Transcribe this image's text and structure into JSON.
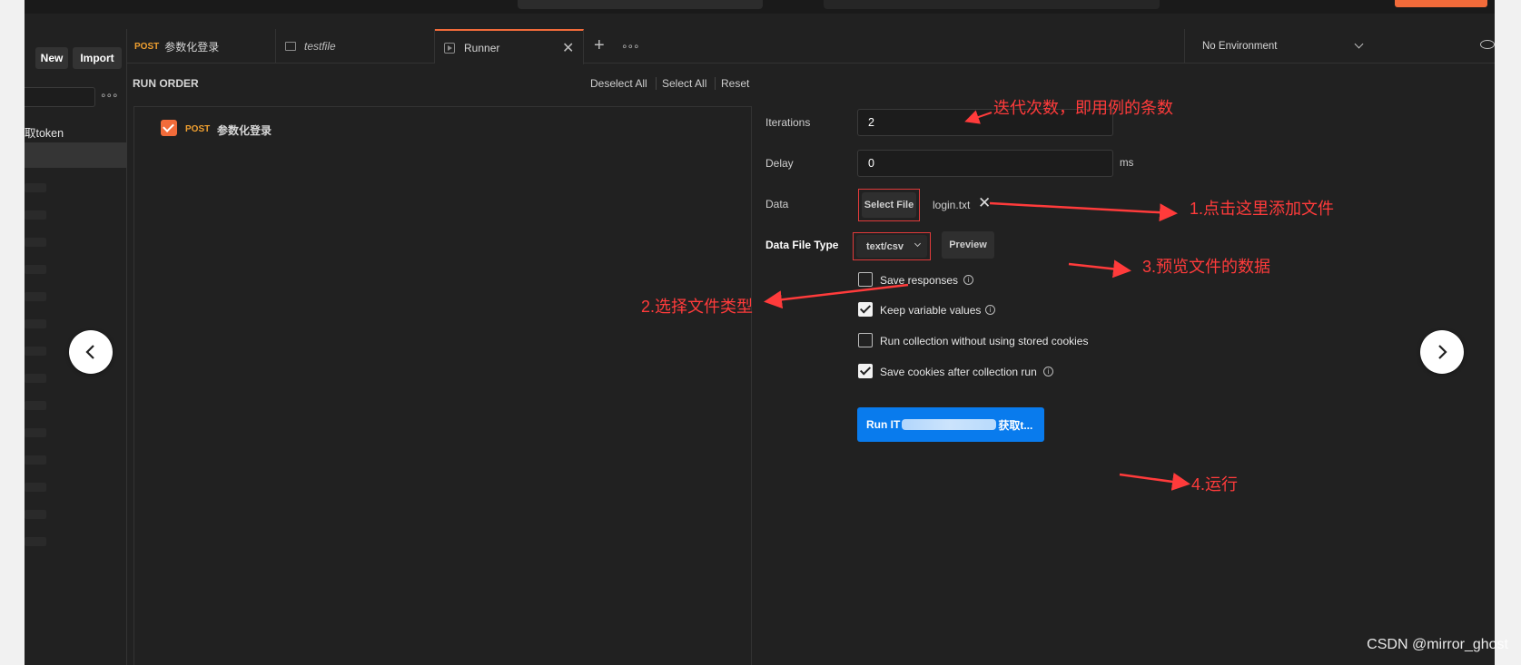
{
  "sidebar": {
    "new_label": "New",
    "import_label": "Import",
    "item_label": "取token"
  },
  "tabs": [
    {
      "method": "POST",
      "label": "参数化登录"
    },
    {
      "label": "testfile"
    },
    {
      "label": "Runner"
    }
  ],
  "environment": {
    "label": "No Environment"
  },
  "run_order": {
    "title": "RUN ORDER",
    "deselect_all": "Deselect All",
    "select_all": "Select All",
    "reset": "Reset",
    "items": [
      {
        "method": "POST",
        "label": "参数化登录",
        "checked": true
      }
    ]
  },
  "settings": {
    "iterations_label": "Iterations",
    "iterations_value": "2",
    "delay_label": "Delay",
    "delay_value": "0",
    "delay_unit": "ms",
    "data_label": "Data",
    "select_file_label": "Select File",
    "file_name": "login.txt",
    "data_file_type_label": "Data File Type",
    "data_file_type_value": "text/csv",
    "preview_label": "Preview",
    "options": [
      {
        "label": "Save responses",
        "checked": false,
        "info": true
      },
      {
        "label": "Keep variable values",
        "checked": true,
        "info": true
      },
      {
        "label": "Run collection without using stored cookies",
        "checked": false,
        "info": false
      },
      {
        "label": "Save cookies after collection run",
        "checked": true,
        "info": true
      }
    ],
    "run_button_prefix": "Run IT",
    "run_button_suffix": "获取t..."
  },
  "annotations": {
    "iterations_note": "迭代次数，即用例的条数",
    "step1": "1.点击这里添加文件",
    "step2": "2.选择文件类型",
    "step3": "3.预览文件的数据",
    "step4": "4.运行",
    "color": "#ff3b3b"
  },
  "watermark": "CSDN @mirror_ghost",
  "colors": {
    "accent": "#f26b3a",
    "run_button": "#097bed",
    "background": "#212121"
  }
}
